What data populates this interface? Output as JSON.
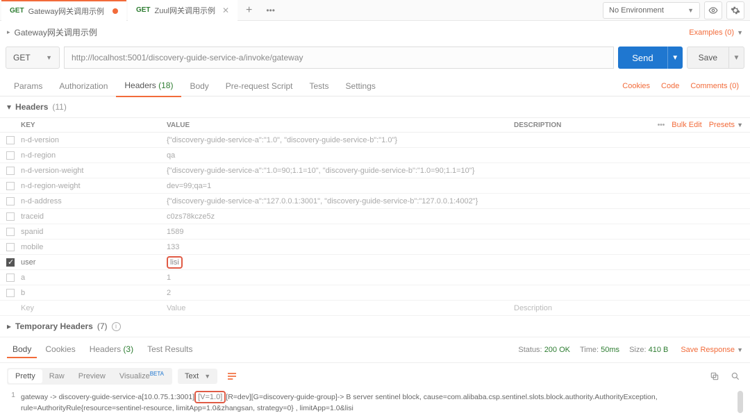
{
  "tabs": [
    {
      "method": "GET",
      "label": "Gateway网关调用示例",
      "modified": true
    },
    {
      "method": "GET",
      "label": "Zuul网关调用示例",
      "modified": false
    }
  ],
  "env": {
    "label": "No Environment"
  },
  "title": "Gateway网关调用示例",
  "examples": {
    "label": "Examples (0)"
  },
  "request": {
    "method": "GET",
    "url": "http://localhost:5001/discovery-guide-service-a/invoke/gateway",
    "send": "Send",
    "save": "Save"
  },
  "reqTabs": {
    "params": "Params",
    "authorization": "Authorization",
    "headers": "Headers",
    "headersCount": "(18)",
    "body": "Body",
    "prerequest": "Pre-request Script",
    "tests": "Tests",
    "settings": "Settings",
    "cookies": "Cookies",
    "code": "Code",
    "comments": "Comments (0)"
  },
  "headersSection": {
    "title": "Headers",
    "count": "(11)",
    "cols": {
      "key": "KEY",
      "value": "VALUE",
      "description": "DESCRIPTION"
    },
    "bulk": "Bulk Edit",
    "presets": "Presets",
    "rows": [
      {
        "checked": false,
        "key": "n-d-version",
        "value": "{\"discovery-guide-service-a\":\"1.0\", \"discovery-guide-service-b\":\"1.0\"}"
      },
      {
        "checked": false,
        "key": "n-d-region",
        "value": "qa"
      },
      {
        "checked": false,
        "key": "n-d-version-weight",
        "value": "{\"discovery-guide-service-a\":\"1.0=90;1.1=10\", \"discovery-guide-service-b\":\"1.0=90;1.1=10\"}"
      },
      {
        "checked": false,
        "key": "n-d-region-weight",
        "value": "dev=99;qa=1"
      },
      {
        "checked": false,
        "key": "n-d-address",
        "value": "{\"discovery-guide-service-a\":\"127.0.0.1:3001\", \"discovery-guide-service-b\":\"127.0.0.1:4002\"}"
      },
      {
        "checked": false,
        "key": "traceid",
        "value": "c0zs78kcze5z"
      },
      {
        "checked": false,
        "key": "spanid",
        "value": "1589"
      },
      {
        "checked": false,
        "key": "mobile",
        "value": "133"
      },
      {
        "checked": true,
        "key": "user",
        "value": "lisi",
        "highlightValue": true
      },
      {
        "checked": false,
        "key": "a",
        "value": "1"
      },
      {
        "checked": false,
        "key": "b",
        "value": "2"
      }
    ],
    "emptyRow": {
      "key": "Key",
      "value": "Value",
      "description": "Description"
    },
    "tempHeaders": {
      "label": "Temporary Headers",
      "count": "(7)"
    }
  },
  "response": {
    "tabs": {
      "body": "Body",
      "cookies": "Cookies",
      "headers": "Headers",
      "headersCount": "(3)",
      "tests": "Test Results"
    },
    "status": {
      "label": "Status:",
      "value": "200 OK"
    },
    "time": {
      "label": "Time:",
      "value": "50ms"
    },
    "size": {
      "label": "Size:",
      "value": "410 B"
    },
    "saveResponse": "Save Response",
    "viewModes": {
      "pretty": "Pretty",
      "raw": "Raw",
      "preview": "Preview",
      "visualize": "Visualize",
      "beta": "BETA"
    },
    "language": "Text",
    "body": {
      "lineNo": "1",
      "pre": "gateway -> discovery-guide-service-a[10.0.75.1:3001]",
      "highlight": "[V=1.0]",
      "post": "[R=dev][G=discovery-guide-group]-> B server sentinel block, cause=com.alibaba.csp.sentinel.slots.block.authority.AuthorityException, rule=AuthorityRule{resource=sentinel-resource, limitApp=1.0&zhangsan, strategy=0} , limitApp=1.0&lisi"
    }
  }
}
